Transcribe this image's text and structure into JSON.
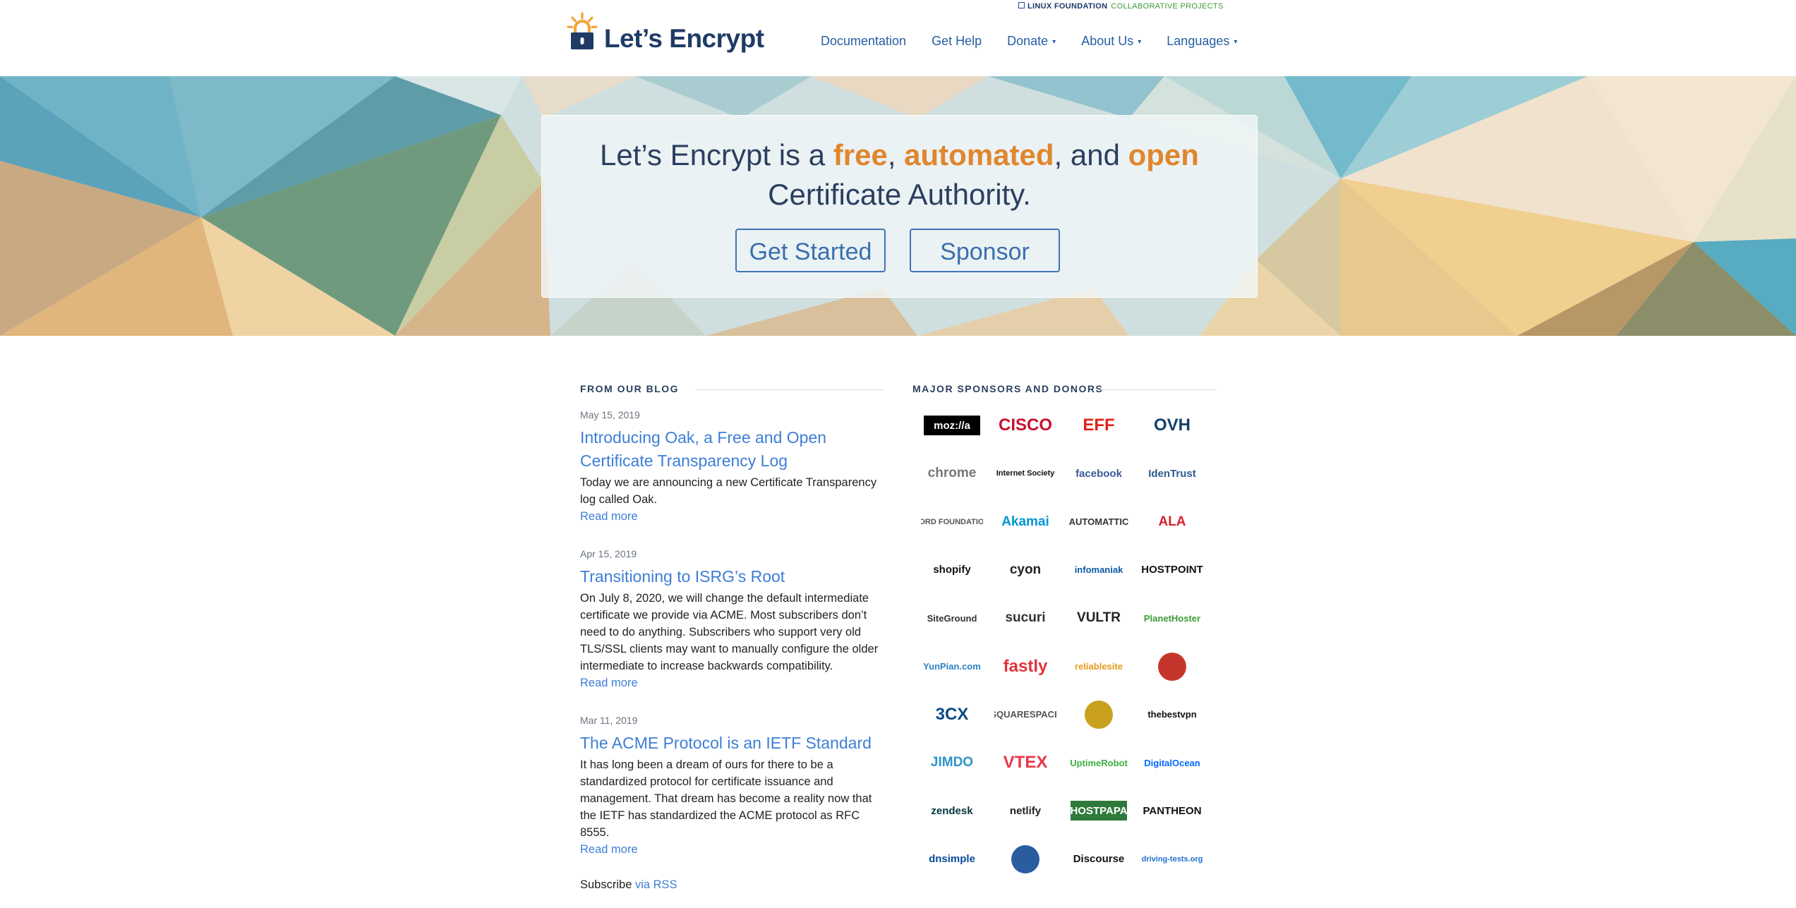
{
  "header": {
    "foundation_name": "LINUX FOUNDATION",
    "foundation_sub": "COLLABORATIVE PROJECTS",
    "logo_text": "Let’s Encrypt",
    "nav": [
      {
        "label": "Documentation",
        "dropdown": false
      },
      {
        "label": "Get Help",
        "dropdown": false
      },
      {
        "label": "Donate",
        "dropdown": true
      },
      {
        "label": "About Us",
        "dropdown": true
      },
      {
        "label": "Languages",
        "dropdown": true
      }
    ],
    "caret": "▾"
  },
  "hero": {
    "prefix": "Let’s Encrypt is a ",
    "free": "free",
    "comma": ", ",
    "automated": "automated",
    "and": ", and ",
    "open": "open",
    "line2": "Certificate Authority.",
    "btn_start": "Get Started",
    "btn_sponsor": "Sponsor"
  },
  "blog": {
    "heading": "FROM OUR BLOG",
    "posts": [
      {
        "date": "May 15, 2019",
        "title": "Introducing Oak, a Free and Open Certificate Transparency Log",
        "summary": "Today we are announcing a new Certificate Transparency log called Oak.",
        "read_more": "Read more"
      },
      {
        "date": "Apr 15, 2019",
        "title": "Transitioning to ISRG’s Root",
        "summary": "On July 8, 2020, we will change the default intermediate certificate we provide via ACME. Most subscribers don’t need to do anything. Subscribers who support very old TLS/SSL clients may want to manually configure the older intermediate to increase backwards compatibility.",
        "read_more": "Read more"
      },
      {
        "date": "Mar 11, 2019",
        "title": "The ACME Protocol is an IETF Standard",
        "summary": "It has long been a dream of ours for there to be a standardized protocol for certificate issuance and management. That dream has become a reality now that the IETF has standardized the ACME protocol as RFC 8555.",
        "read_more": "Read more"
      }
    ],
    "subscribe_prefix": "Subscribe ",
    "subscribe_link": "via RSS"
  },
  "sponsors": {
    "heading": "MAJOR SPONSORS AND DONORS",
    "logos": [
      {
        "name": "moz://a",
        "color": "#ffffff",
        "bg": "#000000"
      },
      {
        "name": "CISCO",
        "color": "#c8102e",
        "bg": ""
      },
      {
        "name": "EFF",
        "color": "#e2231a",
        "bg": ""
      },
      {
        "name": "OVH",
        "color": "#123f6d",
        "bg": ""
      },
      {
        "name": "chrome",
        "color": "#777777",
        "bg": ""
      },
      {
        "name": "Internet Society",
        "color": "#111111",
        "bg": ""
      },
      {
        "name": "facebook",
        "color": "#3b5998",
        "bg": ""
      },
      {
        "name": "IdenTrust",
        "color": "#2c5c8f",
        "bg": ""
      },
      {
        "name": "FORD FOUNDATION",
        "color": "#555555",
        "bg": ""
      },
      {
        "name": "Akamai",
        "color": "#0096d6",
        "bg": ""
      },
      {
        "name": "AUTOMATTIC",
        "color": "#333333",
        "bg": ""
      },
      {
        "name": "ALA",
        "color": "#d7222c",
        "bg": ""
      },
      {
        "name": "shopify",
        "color": "#111111",
        "bg": ""
      },
      {
        "name": "cyon",
        "color": "#222222",
        "bg": ""
      },
      {
        "name": "infomaniak",
        "color": "#0d5aa6",
        "bg": ""
      },
      {
        "name": "HOSTPOINT",
        "color": "#111111",
        "bg": ""
      },
      {
        "name": "SiteGround",
        "color": "#333333",
        "bg": ""
      },
      {
        "name": "sucuri",
        "color": "#333333",
        "bg": ""
      },
      {
        "name": "VULTR",
        "color": "#222222",
        "bg": ""
      },
      {
        "name": "PlanetHoster",
        "color": "#3f9b35",
        "bg": ""
      },
      {
        "name": "YunPian.com",
        "color": "#2a84c4",
        "bg": ""
      },
      {
        "name": "fastly",
        "color": "#e2333d",
        "bg": ""
      },
      {
        "name": "reliablesite",
        "color": "#e59a1d",
        "bg": ""
      },
      {
        "name": "",
        "color": "#c6352b",
        "bg": ""
      },
      {
        "name": "3CX",
        "color": "#0b4b85",
        "bg": ""
      },
      {
        "name": "SQUARESPACE",
        "color": "#555555",
        "bg": ""
      },
      {
        "name": "",
        "color": "#c9a11f",
        "bg": ""
      },
      {
        "name": "thebestvpn",
        "color": "#111111",
        "bg": ""
      },
      {
        "name": "JIMDO",
        "color": "#2c94c9",
        "bg": ""
      },
      {
        "name": "VTEX",
        "color": "#e8364b",
        "bg": ""
      },
      {
        "name": "UptimeRobot",
        "color": "#3bb142",
        "bg": ""
      },
      {
        "name": "DigitalOcean",
        "color": "#0069ff",
        "bg": ""
      },
      {
        "name": "zendesk",
        "color": "#03363d",
        "bg": ""
      },
      {
        "name": "netlify",
        "color": "#222222",
        "bg": ""
      },
      {
        "name": "HOSTPAPA",
        "color": "#ffffff",
        "bg": "#2f7a3a"
      },
      {
        "name": "PANTHEON",
        "color": "#111111",
        "bg": ""
      },
      {
        "name": "dnsimple",
        "color": "#0a4b9b",
        "bg": ""
      },
      {
        "name": "",
        "color": "#2a5ca0",
        "bg": ""
      },
      {
        "name": "Discourse",
        "color": "#111111",
        "bg": ""
      },
      {
        "name": "driving-tests.org",
        "color": "#1f6fd1",
        "bg": ""
      }
    ]
  },
  "theme": {
    "accent": "#e0862d",
    "link": "#3d7ed6",
    "navy": "#1f3b66"
  }
}
